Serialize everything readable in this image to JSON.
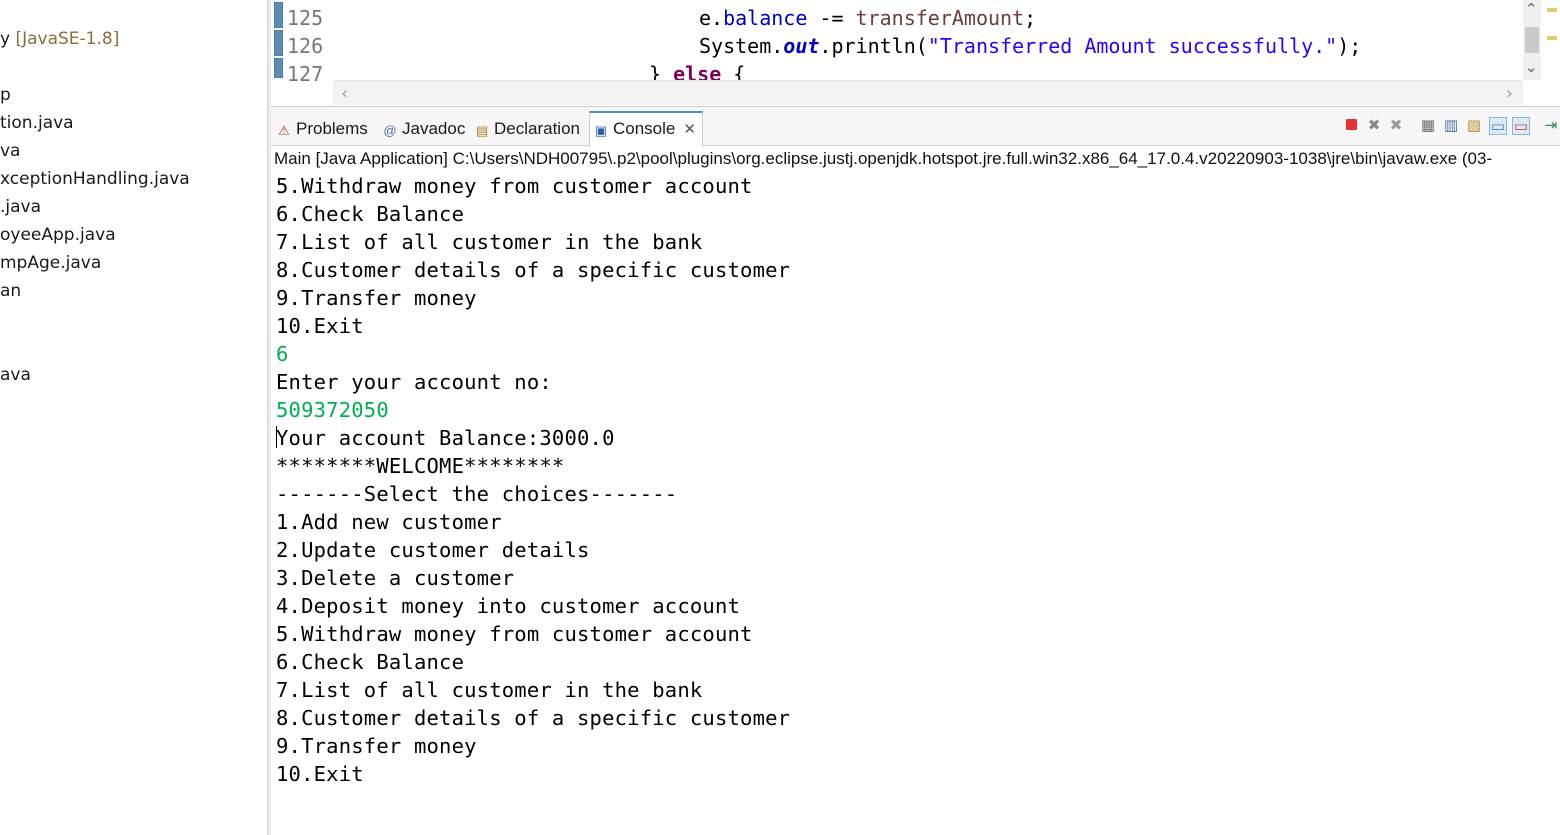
{
  "explorer": {
    "items": [
      {
        "text": "y ",
        "dim": "[JavaSE-1.8]"
      },
      {
        "text": "p"
      },
      {
        "text": "tion.java"
      },
      {
        "text": "va"
      },
      {
        "text": "xceptionHandling.java"
      },
      {
        "text": ".java"
      },
      {
        "text": "oyeeApp.java"
      },
      {
        "text": "mpAge.java"
      },
      {
        "text": "an"
      },
      {
        "text": "ava"
      }
    ]
  },
  "editor": {
    "line_numbers": [
      "125",
      "126",
      "127"
    ],
    "code": {
      "l125_a": "e.",
      "l125_b": "balance",
      "l125_c": " -= ",
      "l125_d": "transferAmount",
      "l125_e": ";",
      "l126_a": "System.",
      "l126_b": "out",
      "l126_c": ".println(",
      "l126_d": "\"Transferred Amount successfully.\"",
      "l126_e": ");",
      "l127_a": "} ",
      "l127_b": "else",
      "l127_c": " {"
    }
  },
  "tabs": {
    "problems": "Problems",
    "javadoc": "Javadoc",
    "declaration": "Declaration",
    "console": "Console"
  },
  "console": {
    "process_label": "Main [Java Application] C:\\Users\\NDH00795\\.p2\\pool\\plugins\\org.eclipse.justj.openjdk.hotspot.jre.full.win32.x86_64_17.0.4.v20220903-1038\\jre\\bin\\javaw.exe  (03-",
    "lines": [
      "5.Withdraw money from customer account",
      "6.Check Balance",
      "7.List of all customer in the bank",
      "8.Customer details of a specific customer",
      "9.Transfer money",
      "10.Exit",
      "6",
      "Enter your account no:",
      "509372050",
      "Your account Balance:3000.0",
      "********WELCOME********",
      "-------Select the choices-------",
      "1.Add new customer",
      "2.Update customer details",
      "3.Delete a customer",
      "4.Deposit money into customer account",
      "5.Withdraw money from customer account",
      "6.Check Balance",
      "7.List of all customer in the bank",
      "8.Customer details of a specific customer",
      "9.Transfer money",
      "10.Exit"
    ]
  },
  "colors": {
    "user_input": "#00b050",
    "keyword": "#7f0055",
    "field": "#0000c0",
    "string": "#2a00ff",
    "active_tab_accent": "#4a90d9",
    "terminate": "#e3342f"
  }
}
